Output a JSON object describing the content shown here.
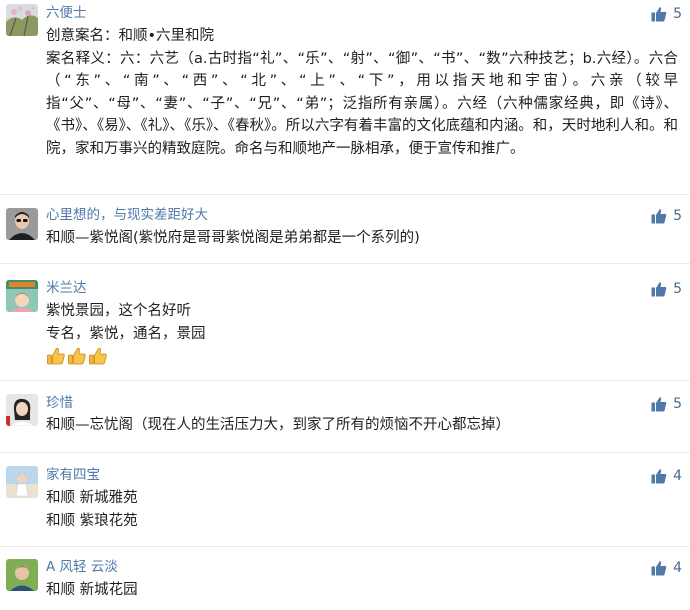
{
  "accent": "#4e79a8",
  "like_icon": "thumbs-up-icon",
  "comments": [
    {
      "username": "六便士",
      "lines": [
        "创意案名：和顺•六里和院",
        "案名释义：六：六艺（a.古时指“礼”、“乐”、“射”、“御”、“书”、“数”六种技艺；b.六经）。六合（“东”、“南”、“西”、“北”、“上”、“下”，用以指天地和宇宙）。六亲（较早指“父”、“母”、“妻”、“子”、“兄”、“弟”；泛指所有亲属）。六经（六种儒家经典，即《诗》、《书》、《易》、《礼》、《乐》、《春秋》。所以六字有着丰富的文化底蕴和内涵。和，天时地利人和。和院，家和万事兴的精致庭院。命名与和顺地产一脉相承，便于宣传和推广。"
      ],
      "likes": "5"
    },
    {
      "username": "心里想的，与现实差距好大",
      "lines": [
        "和顺—紫悦阁(紫悦府是哥哥紫悦阁是弟弟都是一个系列的)"
      ],
      "likes": "5"
    },
    {
      "username": "米兰达",
      "lines": [
        "紫悦景园，这个名好听",
        "专名，紫悦，通名，景园"
      ],
      "emoji": [
        "thumbs-up-emoji",
        "thumbs-up-emoji",
        "thumbs-up-emoji"
      ],
      "likes": "5"
    },
    {
      "username": "珍惜",
      "lines": [
        "和顺—忘忧阁（现在人的生活压力大，到家了所有的烦恼不开心都忘掉）"
      ],
      "likes": "5"
    },
    {
      "username": "家有四宝",
      "lines": [
        "和顺 新城雅苑",
        "和顺 紫琅花苑"
      ],
      "likes": "4"
    },
    {
      "username": "A 风轻  云淡",
      "lines": [
        "和顺 新城花园"
      ],
      "likes": "4"
    }
  ]
}
